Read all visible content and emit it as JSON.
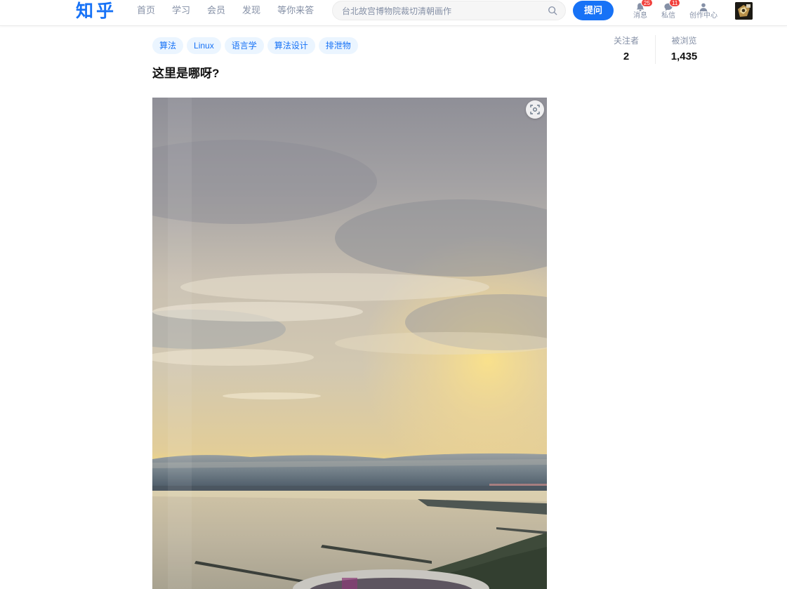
{
  "header": {
    "logo": "知乎",
    "nav": [
      "首页",
      "学习",
      "会员",
      "发现",
      "等你来答"
    ],
    "search_placeholder": "台北故宫博物院裁切清朝画作",
    "ask_button": "提问",
    "messages": {
      "label": "消息",
      "count": "25"
    },
    "private_messages": {
      "label": "私信",
      "count": "11"
    },
    "creator_center": {
      "label": "创作中心"
    }
  },
  "question": {
    "tags": [
      "算法",
      "Linux",
      "语言学",
      "算法设计",
      "排泄物"
    ],
    "title": "这里是哪呀?",
    "followers_label": "关注者",
    "followers_value": "2",
    "views_label": "被浏览",
    "views_value": "1,435"
  },
  "colors": {
    "brand": "#1772f6",
    "tag_bg": "#ebf5ff",
    "badge": "#f1403c",
    "muted_text": "#8590a6"
  },
  "icons": {
    "search": "search-icon",
    "messages": "bell-icon",
    "private_messages": "chat-bubble-icon",
    "creator_center": "person-icon",
    "image_scan": "scan-icon"
  }
}
